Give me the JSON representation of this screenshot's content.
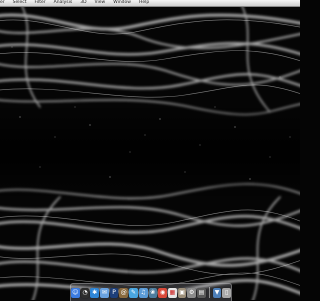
{
  "menubar": {
    "items": [
      {
        "label": "er"
      },
      {
        "label": "Select"
      },
      {
        "label": "Filter"
      },
      {
        "label": "Analysis"
      },
      {
        "label": "3D"
      },
      {
        "label": "View"
      },
      {
        "label": "Window"
      },
      {
        "label": "Help"
      }
    ]
  },
  "dock": {
    "items": [
      {
        "icon": "finder-icon",
        "color": "#3b7be0",
        "glyph": "☺"
      },
      {
        "icon": "dashboard-icon",
        "color": "#2e2e2e",
        "glyph": "◔"
      },
      {
        "icon": "safari-icon",
        "color": "#2f86d6",
        "glyph": "✱"
      },
      {
        "icon": "mail-icon",
        "color": "#6aa2df",
        "glyph": "✉"
      },
      {
        "icon": "photoshop-icon",
        "color": "#1d3f7a",
        "glyph": "P"
      },
      {
        "icon": "address-book-icon",
        "color": "#8a6a3e",
        "glyph": "@"
      },
      {
        "icon": "ichat-icon",
        "color": "#4aa6e0",
        "glyph": "✎"
      },
      {
        "icon": "itunes-icon",
        "color": "#5b9bd6",
        "glyph": "♫"
      },
      {
        "icon": "iphoto-icon",
        "color": "#4e7d9e",
        "glyph": "❀"
      },
      {
        "icon": "chrome-icon",
        "color": "#d94a3a",
        "glyph": "◉"
      },
      {
        "icon": "ical-icon",
        "color": "#e6e6e6",
        "glyph": "▦"
      },
      {
        "icon": "preview-icon",
        "color": "#9c8f7a",
        "glyph": "▣"
      },
      {
        "icon": "system-preferences-icon",
        "color": "#8c8c8c",
        "glyph": "⚙"
      },
      {
        "icon": "activity-monitor-icon",
        "color": "#5a5a5a",
        "glyph": "▤"
      },
      {
        "icon": "downloads-icon",
        "color": "#4d7fb8",
        "glyph": "▼"
      },
      {
        "icon": "trash-icon",
        "color": "#a9a9a9",
        "glyph": "▯"
      }
    ]
  }
}
